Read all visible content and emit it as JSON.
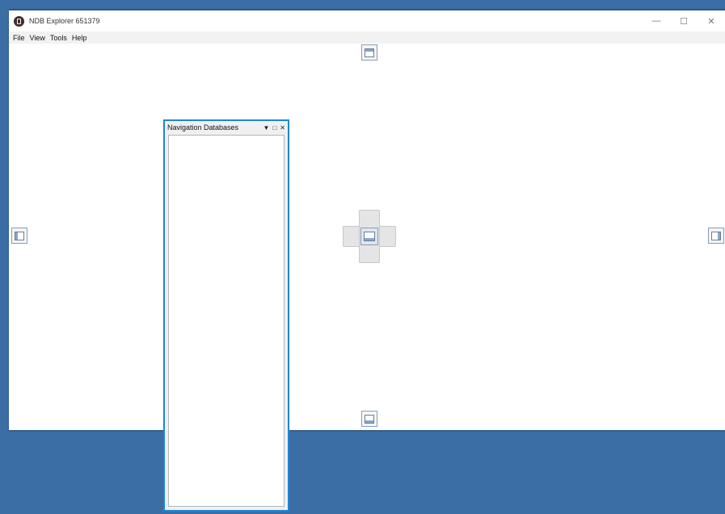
{
  "window": {
    "title": "NDB Explorer 651379",
    "controls": {
      "minimize": "—",
      "maximize": "☐",
      "close": "✕"
    }
  },
  "menu": [
    "File",
    "View",
    "Tools",
    "Help"
  ],
  "panel": {
    "title": "Navigation Databases",
    "controls": {
      "dropdown": "▼",
      "maximize": "□",
      "close": "✕"
    }
  },
  "dock_guides": {
    "top": "dock-top",
    "bottom": "dock-bottom",
    "left": "dock-left",
    "right": "dock-right",
    "center": "dock-center"
  },
  "colors": {
    "desktop": "#3a6ea5",
    "window_border": "#2b5797",
    "panel_border": "#1e86d6",
    "menubar": "#f2f2f2"
  }
}
